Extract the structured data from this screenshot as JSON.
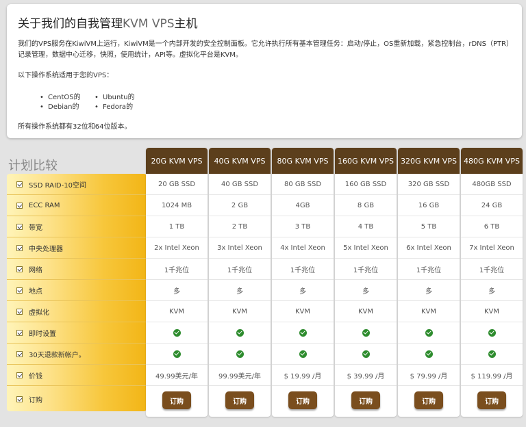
{
  "intro": {
    "title_main": "关于我们的自我管理",
    "title_accent": "KVM VPS",
    "title_tail": "主机",
    "description": "我们的VPS服务在KiwiVM上运行，KiwiVM是一个内部开发的安全控制面板。它允许执行所有基本管理任务：启动/停止，OS重新加载，紧急控制台，rDNS（PTR）记录管理，数据中心迁移，快照，使用统计，API等。虚拟化平台是KVM。",
    "os_lead": "以下操作系统适用于您的VPS：",
    "os_list": [
      "CentOS的",
      "Ubuntu的",
      "Debian的",
      "Fedora的"
    ],
    "footnote": "所有操作系统都有32位和64位版本。"
  },
  "compare": {
    "title": "计划比较",
    "features": [
      "SSD RAID-10空间",
      "ECC RAM",
      "带宽",
      "中央处理器",
      "网络",
      "地点",
      "虚拟化",
      "即时设置",
      "30天退款新帐户。",
      "价钱",
      "订购"
    ],
    "order_label": "订购",
    "plans": [
      {
        "name": "20G KVM VPS",
        "storage": "20 GB SSD",
        "ram": "1024 MB",
        "bandwidth": "1 TB",
        "cpu": "2x Intel Xeon",
        "network": "1千兆位",
        "location": "多",
        "virtualization": "KVM",
        "price": "49.99美元/年"
      },
      {
        "name": "40G KVM VPS",
        "storage": "40 GB SSD",
        "ram": "2 GB",
        "bandwidth": "2 TB",
        "cpu": "3x Intel Xeon",
        "network": "1千兆位",
        "location": "多",
        "virtualization": "KVM",
        "price": "99.99美元/年"
      },
      {
        "name": "80G KVM VPS",
        "storage": "80 GB SSD",
        "ram": "4GB",
        "bandwidth": "3 TB",
        "cpu": "4x Intel Xeon",
        "network": "1千兆位",
        "location": "多",
        "virtualization": "KVM",
        "price": "$ 19.99 /月"
      },
      {
        "name": "160G KVM VPS",
        "storage": "160 GB SSD",
        "ram": "8 GB",
        "bandwidth": "4 TB",
        "cpu": "5x Intel Xeon",
        "network": "1千兆位",
        "location": "多",
        "virtualization": "KVM",
        "price": "$ 39.99 /月"
      },
      {
        "name": "320G KVM VPS",
        "storage": "320 GB SSD",
        "ram": "16 GB",
        "bandwidth": "5 TB",
        "cpu": "6x Intel Xeon",
        "network": "1千兆位",
        "location": "多",
        "virtualization": "KVM",
        "price": "$ 79.99 /月"
      },
      {
        "name": "480G KVM VPS",
        "storage": "480GB SSD",
        "ram": "24 GB",
        "bandwidth": "6 TB",
        "cpu": "7x Intel Xeon",
        "network": "1千兆位",
        "location": "多",
        "virtualization": "KVM",
        "price": "$ 119.99 /月"
      }
    ]
  }
}
